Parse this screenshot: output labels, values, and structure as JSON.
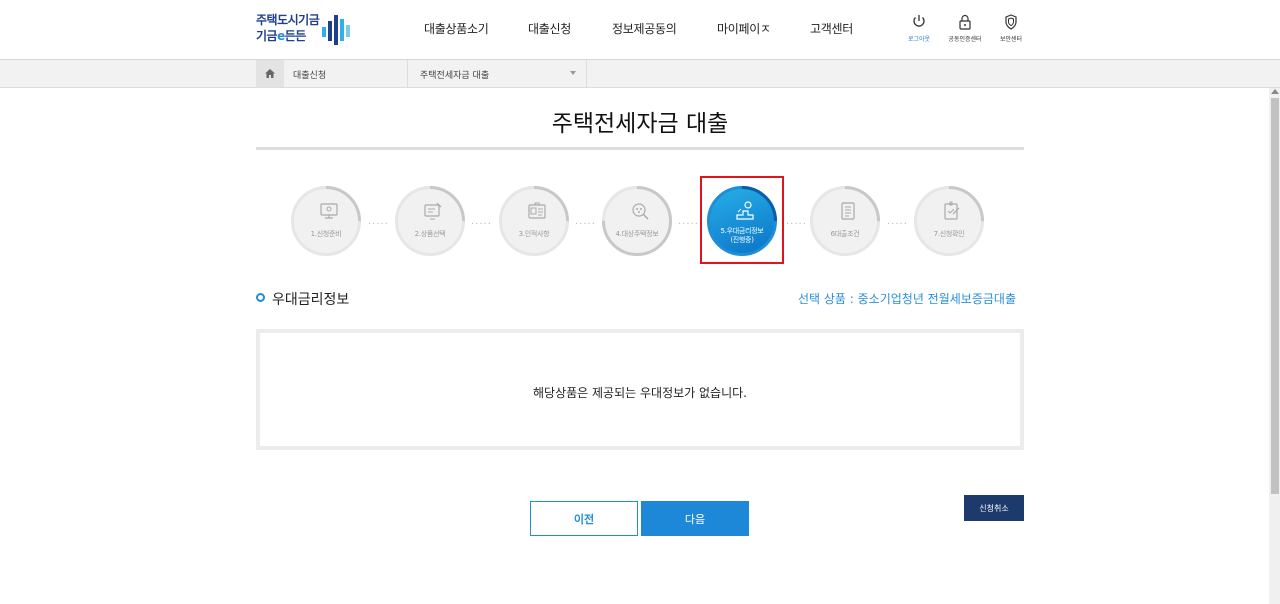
{
  "header": {
    "logo_line1": "주택도시기금",
    "logo_line2_a": "기금",
    "logo_line2_e": "e",
    "logo_line2_b": "든든",
    "nav": [
      "대출상품소기",
      "대출신청",
      "정보제공동의",
      "마이페이ㅈ",
      "고객센터"
    ],
    "utils": [
      "로그아웃",
      "공동인증센터",
      "보안센터"
    ]
  },
  "breadcrumb": {
    "home": "home-icon",
    "level1": "대출신청",
    "level2": "주택전세자금 대출"
  },
  "page": {
    "title": "주택전세자금 대출"
  },
  "steps": [
    {
      "label": "1.신청준비",
      "icon": "monitor-icon"
    },
    {
      "label": "2.상품선택",
      "icon": "product-select-icon"
    },
    {
      "label": "3.인적사항",
      "icon": "id-card-icon"
    },
    {
      "label": "4.대상주택정보",
      "icon": "house-search-icon"
    },
    {
      "label": "5.우대금리정보",
      "label2": "(진행중)",
      "icon": "rate-up-icon",
      "active": true
    },
    {
      "label": "6대출조건",
      "icon": "document-icon"
    },
    {
      "label": "7.신청확인",
      "icon": "check-doc-icon"
    }
  ],
  "section": {
    "title": "우대금리정보",
    "selected_product": "선택 상품 : 중소기업청년 전월세보증금대출"
  },
  "panel": {
    "message": "해당상품은 제공되는 우대정보가 없습니다."
  },
  "buttons": {
    "prev": "이전",
    "next": "다음",
    "cancel": "신청취소"
  },
  "colors": {
    "accent": "#1e88d8",
    "navy": "#1c3a6b",
    "highlight": "#e0141e"
  }
}
